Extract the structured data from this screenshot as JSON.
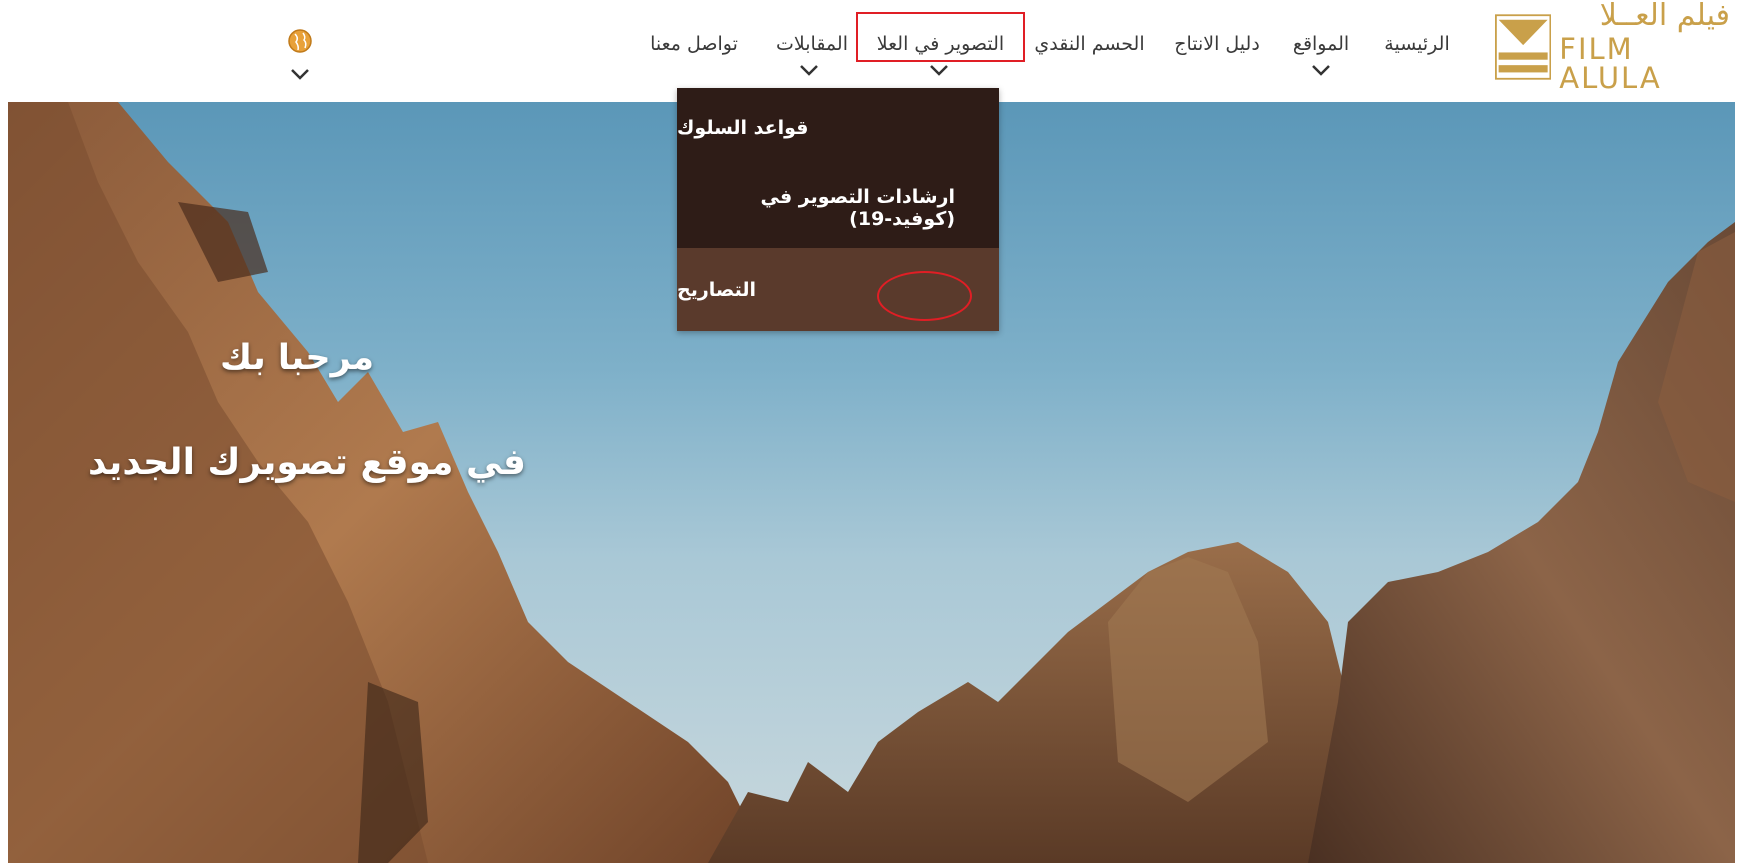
{
  "brand": {
    "name_ar": "فيلم العــلا",
    "name_en": "FILM ALULA",
    "color": "#c9a04a"
  },
  "nav": {
    "home": "الرئيسية",
    "locations": "المواقع",
    "production_guide": "دليل الانتاج",
    "cash_rebate": "الحسم النقدي",
    "filming_in_alula": "التصوير في العلا",
    "interviews": "المقابلات",
    "contact": "تواصل معنا",
    "language_icon": "globe-icon"
  },
  "dropdown": {
    "items": [
      "قواعد السلوك",
      "ارشادات التصوير في (كوفيد-19)",
      "التصاريح"
    ],
    "active_index": 2
  },
  "hero": {
    "line1": "مرحبا بك",
    "line2": "في موقع تصويرك الجديد"
  },
  "colors": {
    "highlight": "#e01e25",
    "dropdown_bg": "#2e1c17",
    "dropdown_active_bg": "#5a3a2c"
  }
}
